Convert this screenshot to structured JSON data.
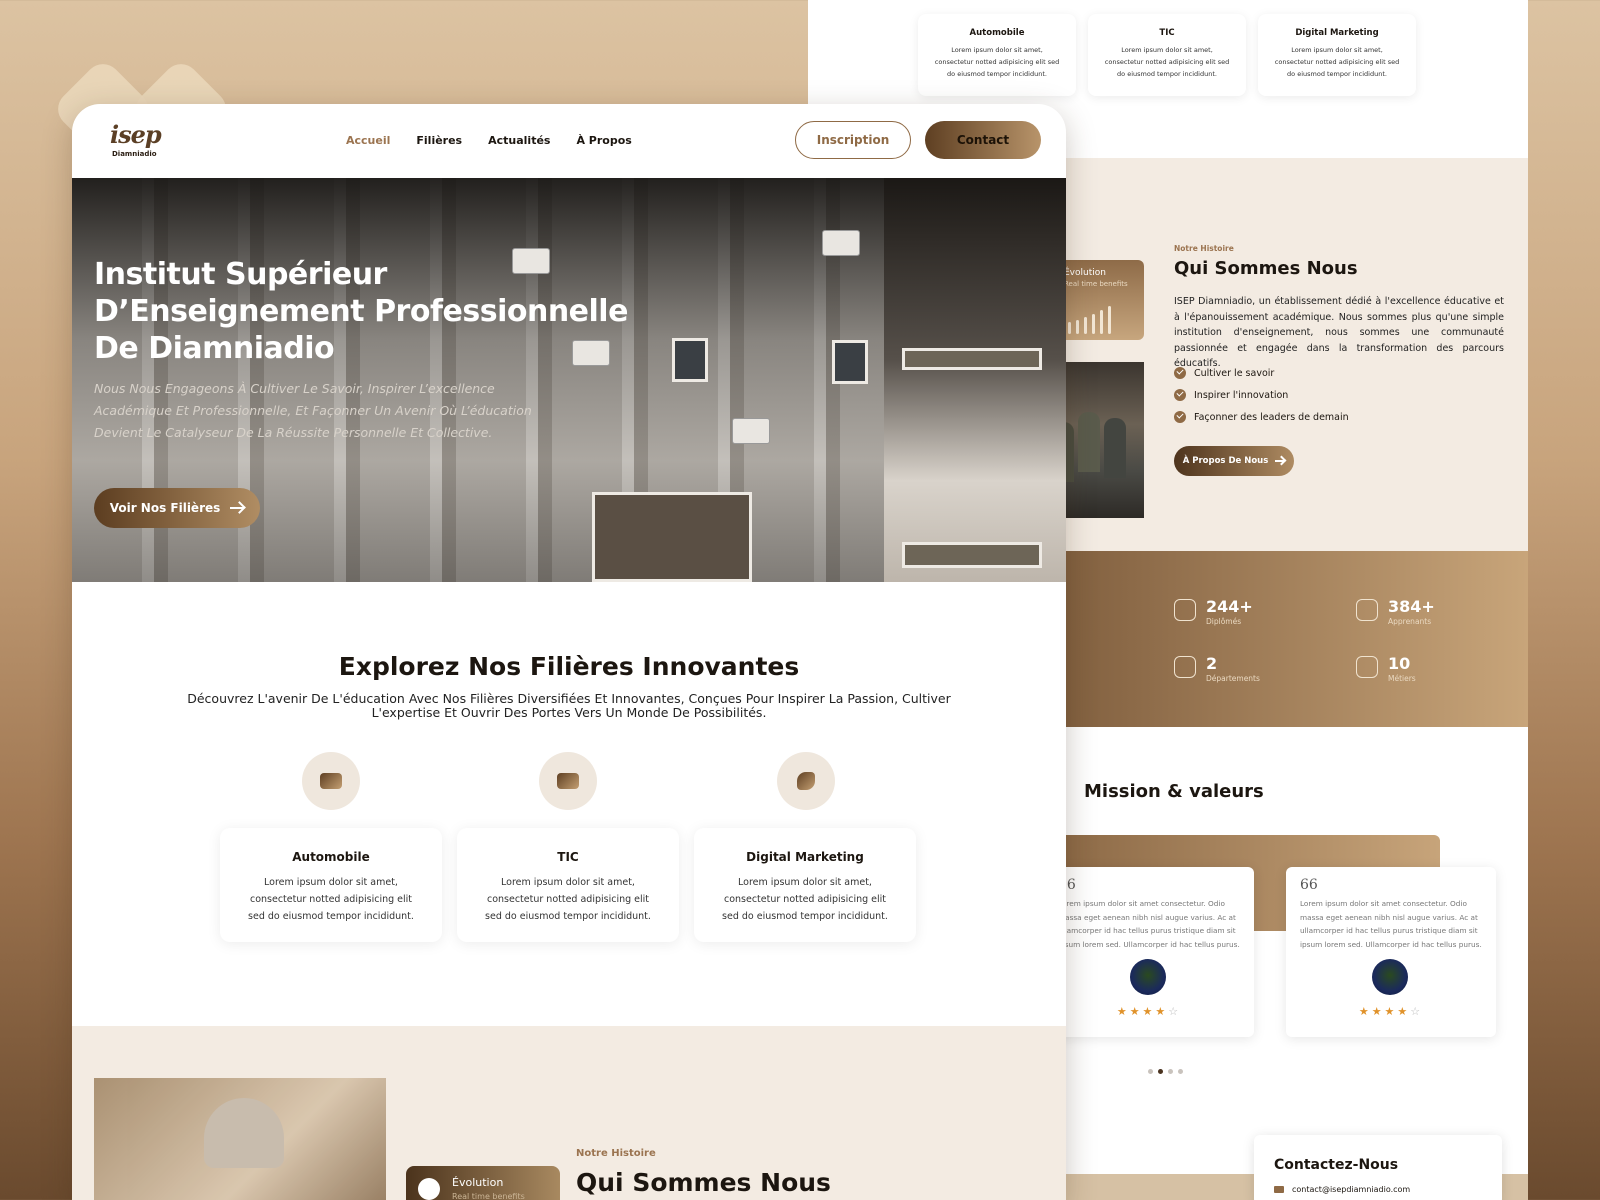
{
  "brand": {
    "logo_text": "isep",
    "logo_sub": "Diamniadio"
  },
  "nav": {
    "items": [
      {
        "label": "Accueil",
        "active": true
      },
      {
        "label": "Filières"
      },
      {
        "label": "Actualités"
      },
      {
        "label": "À Propos"
      }
    ],
    "inscription": "Inscription",
    "contact": "Contact"
  },
  "hero": {
    "title": "Institut Supérieur D’Enseignement Professionnelle De Diamniadio",
    "subtitle": "Nous Nous Engageons À Cultiver Le Savoir, Inspirer L’excellence Académique Et Professionnelle, Et Façonner Un Avenir Où L’éducation Devient Le Catalyseur De La Réussite Personnelle Et Collective.",
    "cta": "Voir Nos Filières"
  },
  "explore": {
    "title": "Explorez Nos Filières Innovantes",
    "lead": "Découvrez L'avenir De L'éducation Avec Nos Filières Diversifiées Et Innovantes, Conçues Pour Inspirer La Passion, Cultiver L'expertise Et Ouvrir Des Portes Vers Un Monde De Possibilités.",
    "cards": [
      {
        "title": "Automobile",
        "icon": "car-icon",
        "text": "Lorem ipsum dolor sit amet, consectetur notted adipisicing elit sed do eiusmod tempor incididunt."
      },
      {
        "title": "TIC",
        "icon": "devices-icon",
        "text": "Lorem ipsum dolor sit amet, consectetur notted adipisicing elit sed do eiusmod tempor incididunt."
      },
      {
        "title": "Digital Marketing",
        "icon": "megaphone-icon",
        "text": "Lorem ipsum dolor sit amet, consectetur notted adipisicing elit sed do eiusmod tempor incididunt."
      }
    ]
  },
  "history": {
    "tag": "Notre Histoire",
    "title": "Qui Sommes Nous",
    "evolution_title": "Évolution",
    "evolution_sub": "Real time benefits"
  },
  "about": {
    "tag": "Notre Histoire",
    "title": "Qui Sommes Nous",
    "evolution_title": "Évolution",
    "evolution_sub": "Real time benefits",
    "paragraph": "ISEP Diamniadio, un établissement dédié à l'excellence éducative et à l'épanouissement académique. Nous sommes plus qu'une simple institution d'enseignement, nous sommes une communauté passionnée et engagée dans la transformation des parcours éducatifs.",
    "bullets": [
      "Cultiver le savoir",
      "Inspirer l'innovation",
      "Façonner des leaders de demain"
    ],
    "button": "À Propos De Nous"
  },
  "stats": [
    {
      "value": "244+",
      "label": "Diplômés",
      "icon": "graduation-cap-icon"
    },
    {
      "value": "384+",
      "label": "Apprenants",
      "icon": "user-icon"
    },
    {
      "value": "2",
      "label": "Départements",
      "icon": "layers-icon"
    },
    {
      "value": "10",
      "label": "Métiers",
      "icon": "briefcase-icon"
    }
  ],
  "mission": {
    "title": "Mission & valeurs",
    "testimonials": [
      {
        "text": "Lorem ipsum dolor sit amet consectetur. Odio massa eget aenean nibh nisl augue varius. Ac at ullamcorper id hac tellus purus tristique diam sit ipsum lorem sed. Ullamcorper id hac tellus purus.",
        "stars": "★★★★",
        "empty": "☆"
      },
      {
        "text": "Lorem ipsum dolor sit amet consectetur. Odio massa eget aenean nibh nisl augue varius. Ac at ullamcorper id hac tellus purus tristique diam sit ipsum lorem sed. Ullamcorper id hac tellus purus.",
        "stars": "★★★★",
        "empty": "☆"
      }
    ],
    "quote_mark": "66"
  },
  "contact": {
    "title": "Contactez-Nous",
    "email": "contact@isepdiamniadio.com"
  },
  "colors": {
    "accent": "#9b7450",
    "dark": "#4b331c",
    "cream": "#f3ebe2"
  }
}
